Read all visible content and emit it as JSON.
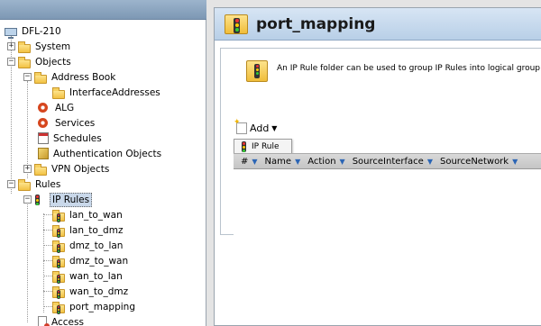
{
  "tree": {
    "root": "DFL-210",
    "system": "System",
    "objects": "Objects",
    "address_book": "Address Book",
    "interface_addresses": "InterfaceAddresses",
    "alg": "ALG",
    "services": "Services",
    "schedules": "Schedules",
    "auth_objects": "Authentication Objects",
    "vpn_objects": "VPN Objects",
    "rules": "Rules",
    "ip_rules": "IP Rules",
    "rule_items": [
      "lan_to_wan",
      "lan_to_dmz",
      "dmz_to_lan",
      "dmz_to_wan",
      "wan_to_lan",
      "wan_to_dmz",
      "port_mapping"
    ],
    "access": "Access"
  },
  "panel": {
    "title": "port_mapping",
    "info": "An IP Rule folder can be used to group IP Rules into logical group",
    "add_label": "Add",
    "dropdown_item": "IP Rule",
    "columns": [
      "#",
      "Name",
      "Action",
      "SourceInterface",
      "SourceNetwork"
    ]
  },
  "colors": {
    "header_bg": "#c9dbee",
    "selection": "#c9d8ea",
    "sort_arrow": "#2b65b5"
  }
}
